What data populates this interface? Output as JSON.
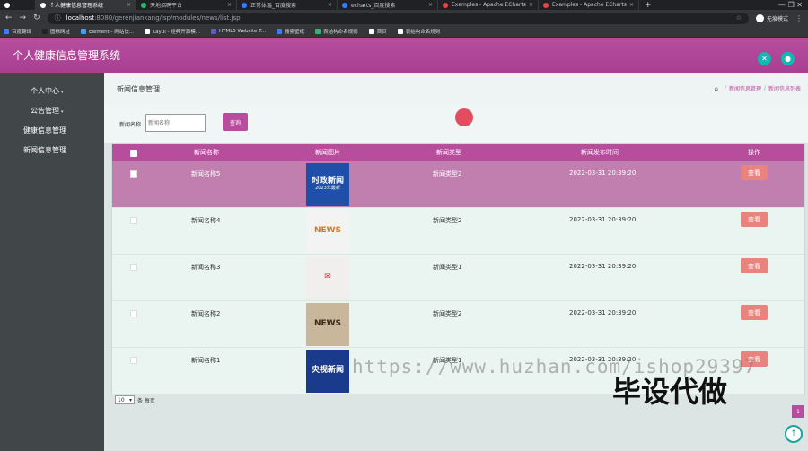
{
  "browser": {
    "tabs": [
      {
        "label": "",
        "color": "#ffffff"
      },
      {
        "label": "个人健康信息管理系统",
        "color": "#ffffff",
        "active": true
      },
      {
        "label": "天地招聘平台",
        "color": "#2bb673"
      },
      {
        "label": "正常体温_百度搜索",
        "color": "#3b7bff"
      },
      {
        "label": "echarts_百度搜索",
        "color": "#3b7bff"
      },
      {
        "label": "Examples - Apache ECharts",
        "color": "#e0464e"
      },
      {
        "label": "Examples - Apache ECharts",
        "color": "#e0464e"
      }
    ],
    "url_host": "localhost",
    "url_path": ":8080/gerenjiankang/jsp/modules/news/list.jsp",
    "profile_label": "无痕模式",
    "bookmarks": [
      {
        "label": "百度翻译",
        "color": "#3b7bff"
      },
      {
        "label": "图标网址",
        "color": "#222222"
      },
      {
        "label": "Element - 网站快...",
        "color": "#409eff"
      },
      {
        "label": "Layui - 经典开源模...",
        "color": "#ffffff"
      },
      {
        "label": "HTML5 Website T...",
        "color": "#5b5bd6"
      },
      {
        "label": "搜索壁纸",
        "color": "#3b7bff"
      },
      {
        "label": "表结构命名规则",
        "color": "#2bb673"
      },
      {
        "label": "首页",
        "color": "#ffffff"
      },
      {
        "label": "表结构命名规则",
        "color": "#ffffff"
      }
    ]
  },
  "app": {
    "title": "个人健康信息管理系统",
    "accent": "#b84d9e"
  },
  "sidebar": {
    "items": [
      {
        "label": "个人中心",
        "caret": "▾"
      },
      {
        "label": "公告管理",
        "caret": "▾"
      },
      {
        "label": "健康信息管理",
        "caret": ""
      },
      {
        "label": "新闻信息管理",
        "caret": ""
      }
    ]
  },
  "main": {
    "page_title": "新闻信息管理",
    "breadcrumb": [
      "新闻信息管理",
      "新闻信息列表"
    ],
    "search": {
      "label": "新闻名称",
      "placeholder": "新闻名称",
      "button": "查询"
    },
    "table": {
      "headers": [
        "新闻名称",
        "新闻图片",
        "新闻类型",
        "新闻发布时间",
        "操作"
      ],
      "rows": [
        {
          "name": "新闻名称5",
          "type": "新闻类型2",
          "time": "2022-03-31 20:39:20",
          "action": "查看",
          "thumb_text": "时政新闻",
          "thumb_sub": "2023年最新",
          "thumb_bg": "#1f4fa8",
          "thumb_fg": "#ffffff"
        },
        {
          "name": "新闻名称4",
          "type": "新闻类型2",
          "time": "2022-03-31 20:39:20",
          "action": "查看",
          "thumb_text": "NEWS",
          "thumb_sub": "",
          "thumb_bg": "#f3f3f3",
          "thumb_fg": "#d97a1a"
        },
        {
          "name": "新闻名称3",
          "type": "新闻类型1",
          "time": "2022-03-31 20:39:20",
          "action": "查看",
          "thumb_text": "✉",
          "thumb_sub": "",
          "thumb_bg": "#f1eeee",
          "thumb_fg": "#c0392b"
        },
        {
          "name": "新闻名称2",
          "type": "新闻类型2",
          "time": "2022-03-31 20:39:20",
          "action": "查看",
          "thumb_text": "NEWS",
          "thumb_sub": "",
          "thumb_bg": "#c8b79a",
          "thumb_fg": "#3a2a1a"
        },
        {
          "name": "新闻名称1",
          "type": "新闻类型1",
          "time": "2022-03-31 20:39:20",
          "action": "查看",
          "thumb_text": "央视新闻",
          "thumb_sub": "",
          "thumb_bg": "#1a3b8c",
          "thumb_fg": "#ffffff"
        }
      ]
    },
    "pager": {
      "page_size": "10",
      "page_size_suffix": "条 每页",
      "current_page": "1"
    }
  },
  "overlays": {
    "watermark": "https://www.huzhan.com/ishop29397",
    "big_text": "毕设代做"
  }
}
